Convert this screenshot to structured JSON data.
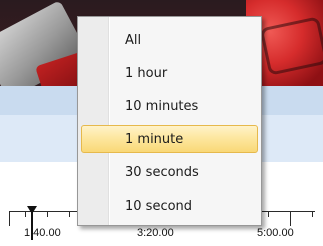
{
  "menu": {
    "items": [
      {
        "label": "All",
        "selected": false
      },
      {
        "label": "1 hour",
        "selected": false
      },
      {
        "label": "10 minutes",
        "selected": false
      },
      {
        "label": "1 minute",
        "selected": true
      },
      {
        "label": "30 seconds",
        "selected": false
      },
      {
        "label": "10 second",
        "selected": false
      }
    ]
  },
  "timeline": {
    "tick_labels": [
      "1:40.00",
      "3:20.00",
      "5:00.00"
    ]
  },
  "colors": {
    "selected_item_background": "#fde7a0",
    "selected_item_border": "#e6b94c",
    "panel_background": "#dde9f7"
  }
}
